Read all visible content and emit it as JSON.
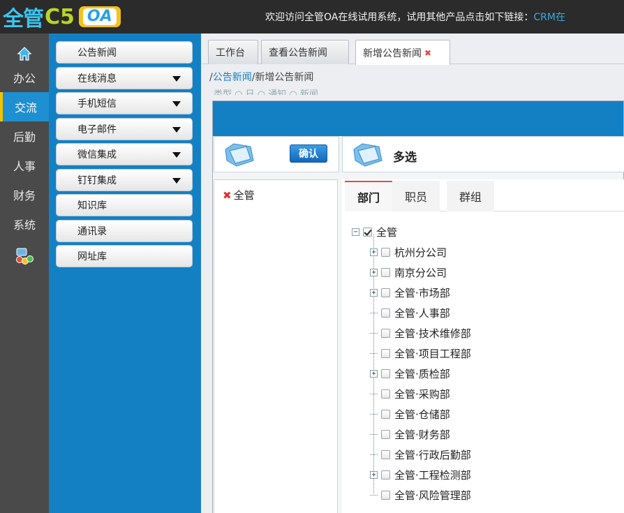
{
  "header": {
    "logo_main": "全管",
    "logo_c5": "C5",
    "logo_oa": "OA",
    "welcome_text": "欢迎访问全管OA在线试用系统，试用其他产品点击如下链接：",
    "welcome_link": "CRM在"
  },
  "leftnav": {
    "items": [
      "办公",
      "交流",
      "后勤",
      "人事",
      "财务",
      "系统"
    ],
    "active": "交流"
  },
  "submenu": {
    "items": [
      {
        "label": "公告新闻",
        "has_arrow": false
      },
      {
        "label": "在线消息",
        "has_arrow": true
      },
      {
        "label": "手机短信",
        "has_arrow": true
      },
      {
        "label": "电子邮件",
        "has_arrow": true
      },
      {
        "label": "微信集成",
        "has_arrow": true
      },
      {
        "label": "钉钉集成",
        "has_arrow": true
      },
      {
        "label": "知识库",
        "has_arrow": false
      },
      {
        "label": "通讯录",
        "has_arrow": false
      },
      {
        "label": "网址库",
        "has_arrow": false
      }
    ]
  },
  "tabs": [
    {
      "label": "工作台",
      "active": false
    },
    {
      "label": "查看公告新闻",
      "active": false
    },
    {
      "label": "新增公告新闻",
      "active": true,
      "close": "✖"
    }
  ],
  "breadcrumb": {
    "sep": "/",
    "parent": "公告新闻",
    "current": "新增公告新闻"
  },
  "ghost_text": "类型   ○ 日  ○ 通知 ○ 新闻",
  "dialog": {
    "confirm_label": "确认",
    "title": "多选",
    "selected": [
      {
        "label": "全管",
        "remove": "✖"
      }
    ],
    "tree_tabs": [
      {
        "label": "部门",
        "active": true
      },
      {
        "label": "职员",
        "active": false
      },
      {
        "label": "群组",
        "active": false
      }
    ],
    "tree": {
      "root": {
        "label": "全管",
        "checked": true,
        "expander": "−"
      },
      "children": [
        {
          "label": "杭州分公司",
          "expandable": true
        },
        {
          "label": "南京分公司",
          "expandable": true
        },
        {
          "label": "全管·市场部",
          "expandable": true
        },
        {
          "label": "全管·人事部",
          "expandable": false
        },
        {
          "label": "全管·技术维修部",
          "expandable": false
        },
        {
          "label": "全管·项目工程部",
          "expandable": false
        },
        {
          "label": "全管·质检部",
          "expandable": true
        },
        {
          "label": "全管·采购部",
          "expandable": false
        },
        {
          "label": "全管·仓储部",
          "expandable": false
        },
        {
          "label": "全管·财务部",
          "expandable": false
        },
        {
          "label": "全管·行政后勤部",
          "expandable": false
        },
        {
          "label": "全管·工程检测部",
          "expandable": true
        },
        {
          "label": "全管·风险管理部",
          "expandable": false
        }
      ]
    }
  }
}
